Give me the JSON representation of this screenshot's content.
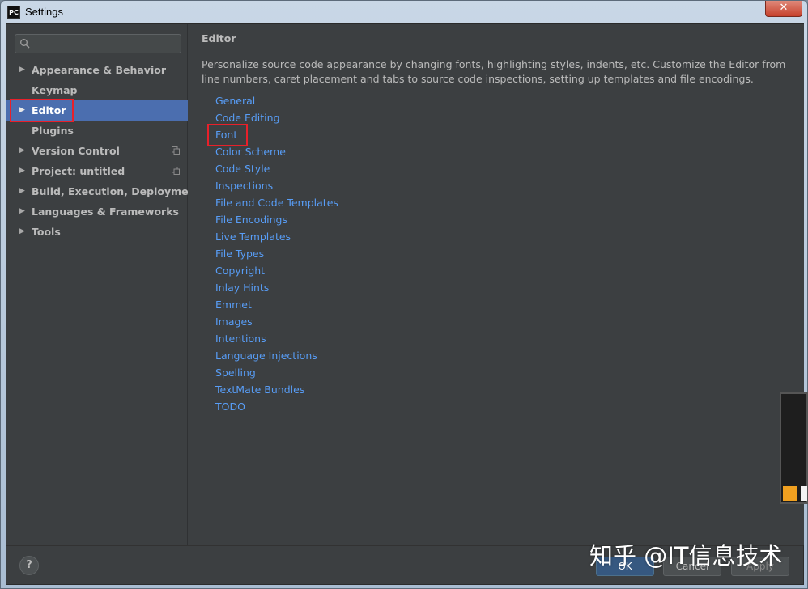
{
  "window": {
    "title": "Settings",
    "app_icon_text": "PC",
    "close_label": "✕"
  },
  "search": {
    "value": "",
    "placeholder": ""
  },
  "sidebar": {
    "items": [
      {
        "label": "Appearance & Behavior",
        "expandable": true,
        "selected": false
      },
      {
        "label": "Keymap",
        "expandable": false,
        "selected": false
      },
      {
        "label": "Editor",
        "expandable": true,
        "selected": true
      },
      {
        "label": "Plugins",
        "expandable": false,
        "selected": false
      },
      {
        "label": "Version Control",
        "expandable": true,
        "selected": false,
        "icon": "copy-icon"
      },
      {
        "label": "Project: untitled",
        "expandable": true,
        "selected": false,
        "icon": "copy-icon"
      },
      {
        "label": "Build, Execution, Deployment",
        "expandable": true,
        "selected": false
      },
      {
        "label": "Languages & Frameworks",
        "expandable": true,
        "selected": false
      },
      {
        "label": "Tools",
        "expandable": true,
        "selected": false
      }
    ]
  },
  "content": {
    "title": "Editor",
    "description": "Personalize source code appearance by changing fonts, highlighting styles, indents, etc. Customize the Editor from line numbers, caret placement and tabs to source code inspections, setting up templates and file encodings.",
    "links": [
      "General",
      "Code Editing",
      "Font",
      "Color Scheme",
      "Code Style",
      "Inspections",
      "File and Code Templates",
      "File Encodings",
      "Live Templates",
      "File Types",
      "Copyright",
      "Inlay Hints",
      "Emmet",
      "Images",
      "Intentions",
      "Language Injections",
      "Spelling",
      "TextMate Bundles",
      "TODO"
    ]
  },
  "footer": {
    "help_label": "?",
    "ok_label": "OK",
    "cancel_label": "Cancel",
    "apply_label": "Apply"
  },
  "watermark": {
    "text": "知乎 @IT信息技术"
  },
  "colors": {
    "accent": "#4b6eaf",
    "link": "#589df6",
    "background": "#3c3f41",
    "highlight_box": "#e8202a",
    "text": "#bbbbbb"
  }
}
